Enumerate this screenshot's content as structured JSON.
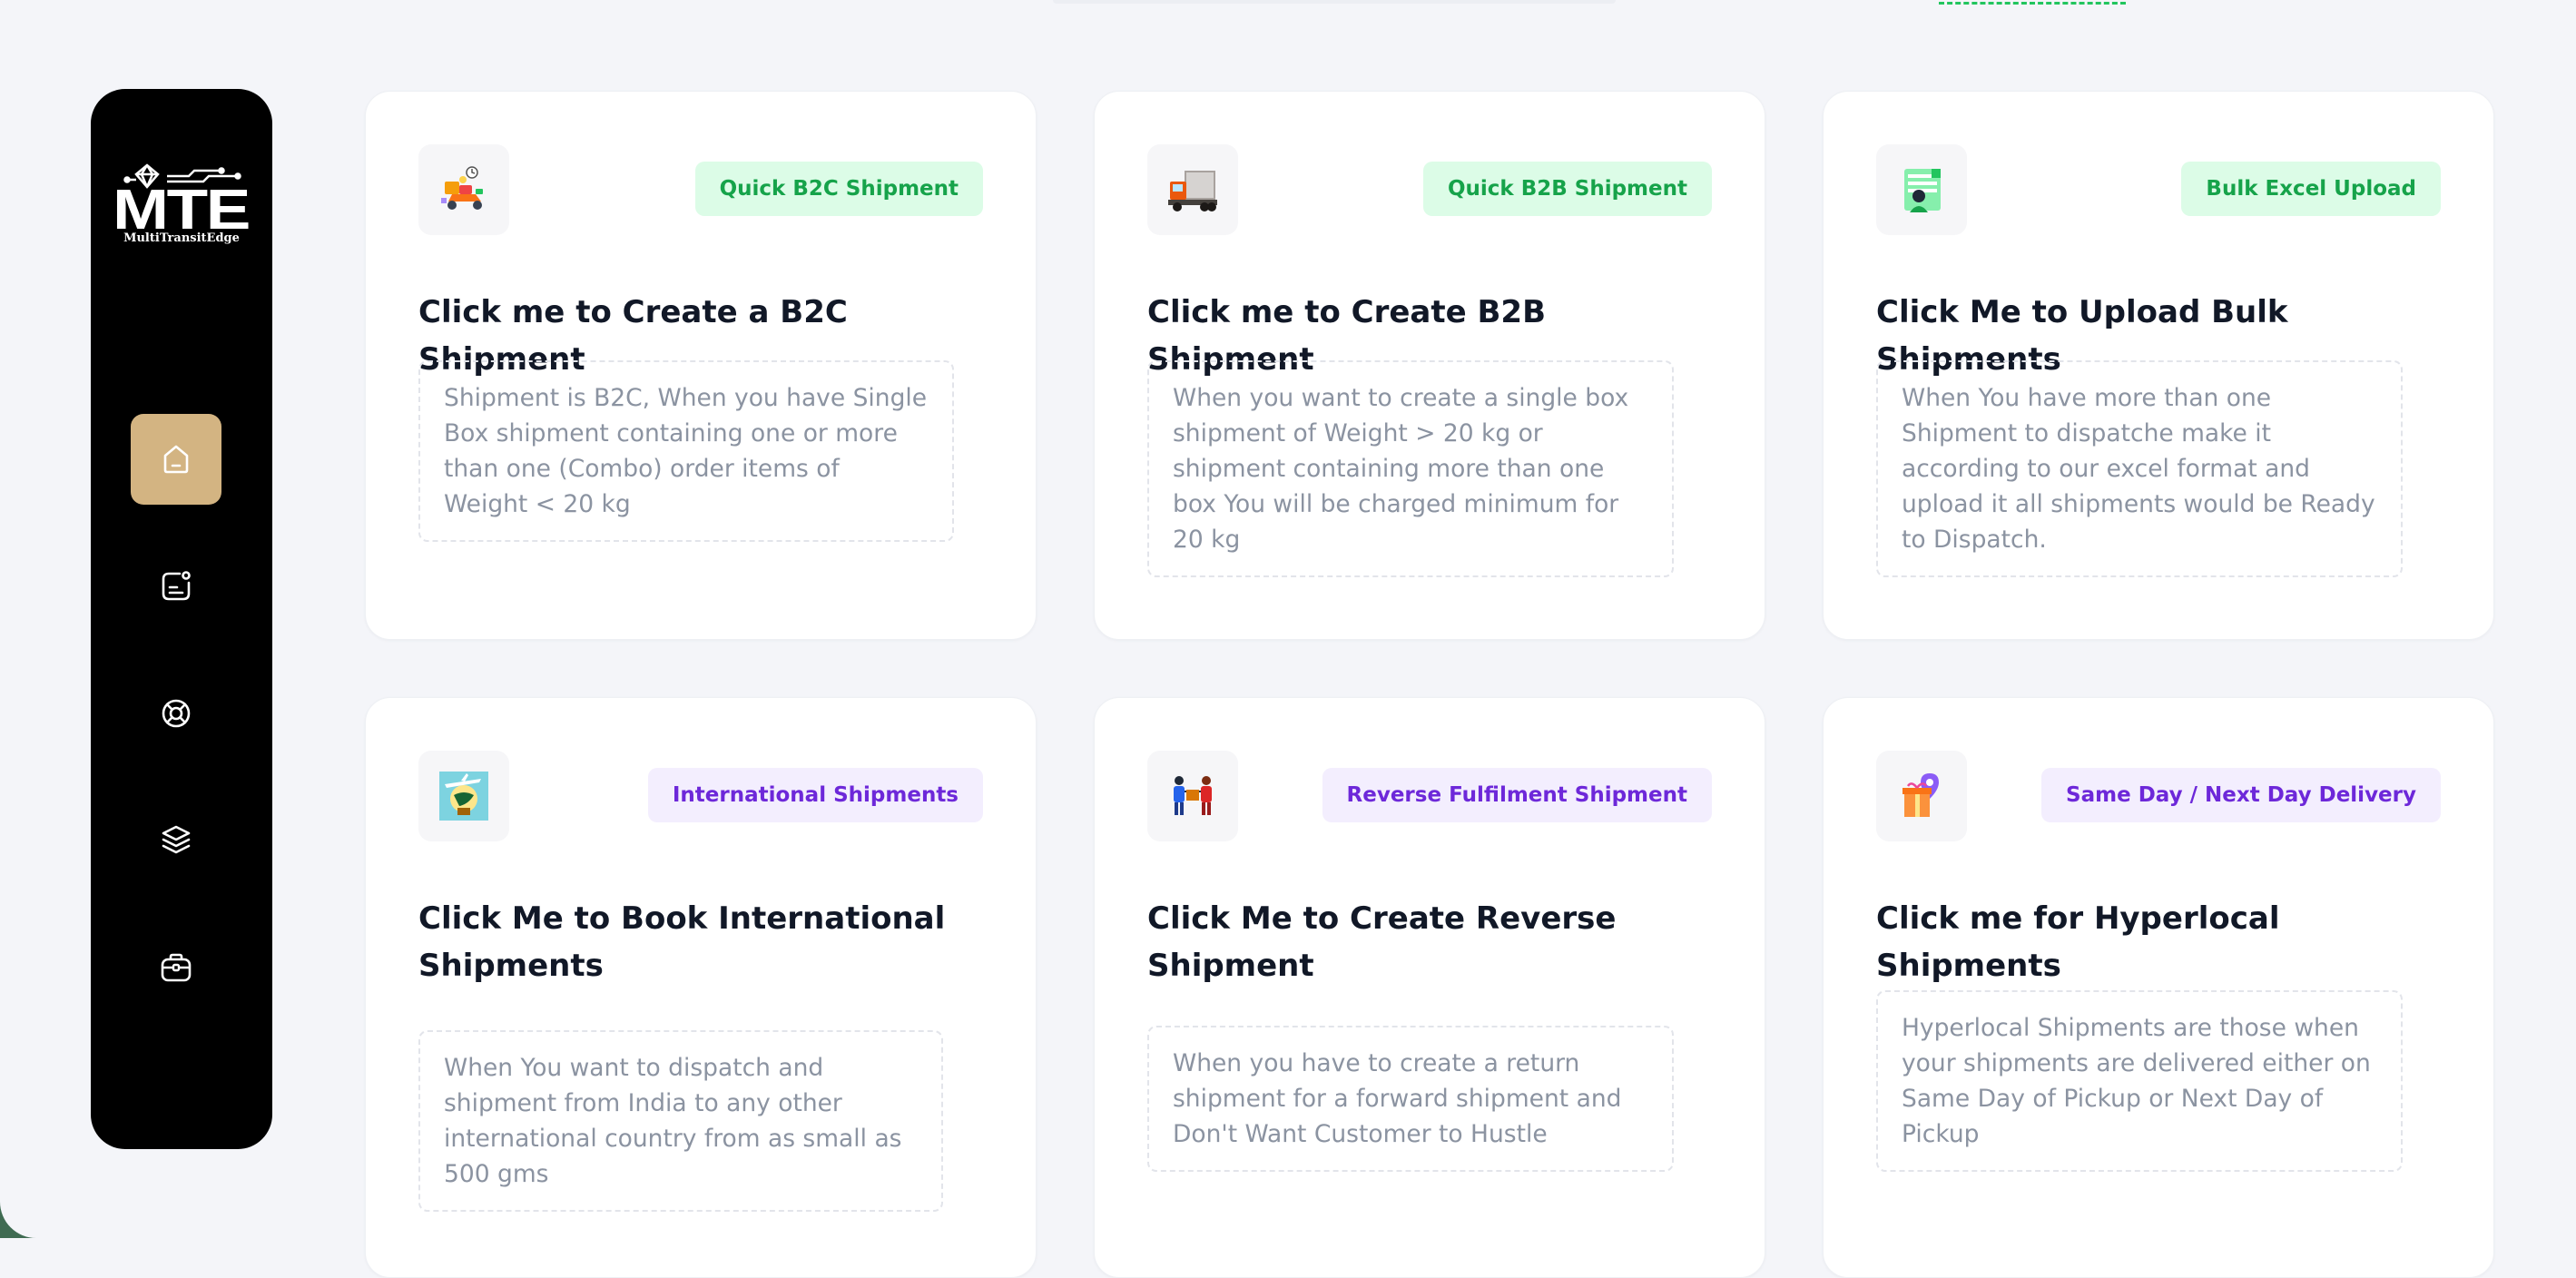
{
  "brand": {
    "logo_text": "MTE",
    "logo_subtitle": "MultiTransitEdge"
  },
  "sidebar": {
    "items": [
      {
        "name": "home",
        "icon": "home-icon",
        "active": true
      },
      {
        "name": "orders",
        "icon": "document-icon",
        "active": false
      },
      {
        "name": "support",
        "icon": "lifebuoy-icon",
        "active": false
      },
      {
        "name": "layers",
        "icon": "layers-icon",
        "active": false
      },
      {
        "name": "business",
        "icon": "briefcase-icon",
        "active": false
      }
    ],
    "active_color": "#d3b482"
  },
  "cards": [
    {
      "badge": "Quick B2C Shipment",
      "badge_color": "green",
      "icon": "delivery-scooter-icon",
      "title": "Click me to Create a B2C Shipment",
      "description": "Shipment is B2C, When you have Single Box shipment containing one or more than one (Combo) order items of Weight < 20 kg"
    },
    {
      "badge": "Quick B2B Shipment",
      "badge_color": "green",
      "icon": "truck-icon",
      "title": "Click me to Create B2B Shipment",
      "description": "When you want to create a single box shipment of Weight > 20 kg or shipment containing more than one box You will be charged minimum for 20 kg"
    },
    {
      "badge": "Bulk Excel Upload",
      "badge_color": "green",
      "icon": "excel-upload-icon",
      "title": "Click Me to Upload Bulk Shipments",
      "description": "When You have more than one Shipment to dispatche make it according to our excel format and upload it all shipments would be Ready to Dispatch."
    },
    {
      "badge": "International Shipments",
      "badge_color": "purple",
      "icon": "globe-plane-icon",
      "title": "Click Me to Book International Shipments",
      "description": "When You want to dispatch and shipment from India to any other international country from as small as 500 gms"
    },
    {
      "badge": "Reverse Fulfilment Shipment",
      "badge_color": "purple",
      "icon": "package-handover-icon",
      "title": "Click Me to Create Reverse Shipment",
      "description": "When you have to create a return shipment for a forward shipment and Don't Want Customer to Hustle"
    },
    {
      "badge": "Same Day / Next Day Delivery",
      "badge_color": "purple",
      "icon": "gift-location-icon",
      "title": "Click me for Hyperlocal Shipments",
      "description": "Hyperlocal Shipments are those when your shipments are delivered either on Same Day of Pickup or Next Day of Pickup"
    }
  ]
}
